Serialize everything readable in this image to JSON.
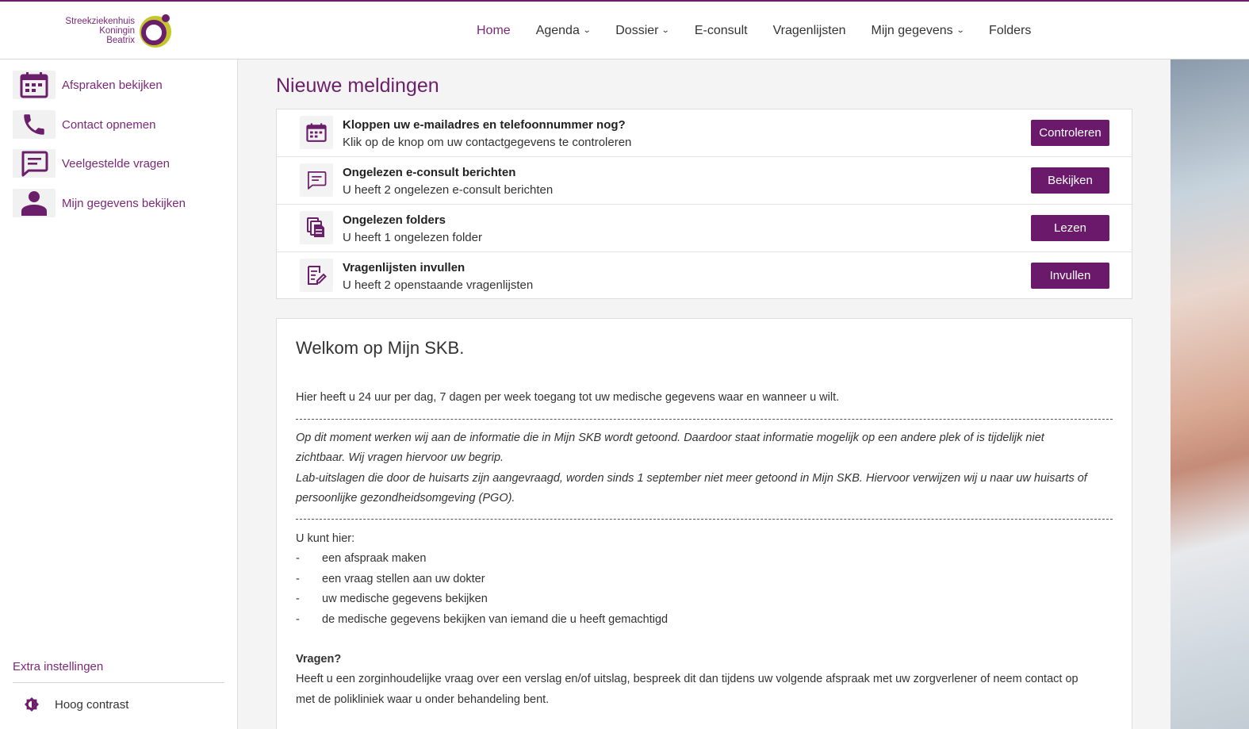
{
  "brand": {
    "logo_text": [
      "Streekziekenhuis",
      "Koningin",
      "Beatrix"
    ],
    "accent": "#7a2878",
    "button_color": "#6b1a6b"
  },
  "nav": [
    {
      "label": "Home",
      "active": true,
      "dropdown": false
    },
    {
      "label": "Agenda",
      "active": false,
      "dropdown": true
    },
    {
      "label": "Dossier",
      "active": false,
      "dropdown": true
    },
    {
      "label": "E-consult",
      "active": false,
      "dropdown": false
    },
    {
      "label": "Vragenlijsten",
      "active": false,
      "dropdown": false
    },
    {
      "label": "Mijn gegevens",
      "active": false,
      "dropdown": true
    },
    {
      "label": "Folders",
      "active": false,
      "dropdown": false
    }
  ],
  "sidebar": {
    "items": [
      {
        "label": "Afspraken bekijken",
        "icon": "calendar-icon"
      },
      {
        "label": "Contact opnemen",
        "icon": "phone-icon"
      },
      {
        "label": "Veelgestelde vragen",
        "icon": "chat-icon"
      },
      {
        "label": "Mijn gegevens bekijken",
        "icon": "person-icon"
      }
    ],
    "extra_title": "Extra instellingen",
    "contrast_label": "Hoog contrast"
  },
  "main": {
    "title": "Nieuwe meldingen",
    "notifications": [
      {
        "title": "Kloppen uw e-mailadres en telefoonnummer nog?",
        "subtitle": "Klik op de knop om uw contactgegevens te controleren",
        "button": "Controleren",
        "icon": "calendar-icon"
      },
      {
        "title": "Ongelezen e-consult berichten",
        "subtitle": "U heeft 2 ongelezen e-consult berichten",
        "button": "Bekijken",
        "icon": "chat-icon"
      },
      {
        "title": "Ongelezen folders",
        "subtitle": "U heeft 1 ongelezen folder",
        "button": "Lezen",
        "icon": "folders-icon"
      },
      {
        "title": "Vragenlijsten invullen",
        "subtitle": "U heeft 2 openstaande vragenlijsten",
        "button": "Invullen",
        "icon": "edit-list-icon"
      }
    ]
  },
  "welcome": {
    "title": "Welkom op Mijn SKB.",
    "intro": "Hier heeft u 24 uur per dag, 7 dagen per week toegang tot uw medische gegevens waar en wanneer u wilt.",
    "notice_lines": [
      "Op dit moment werken wij aan de informatie die in Mijn SKB wordt getoond. Daardoor staat informatie mogelijk op een andere plek of is tijdelijk niet",
      "zichtbaar. Wij vragen hiervoor uw begrip.",
      "Lab-uitslagen die door de huisarts zijn aangevraagd, worden sinds 1 september niet meer getoond in Mijn SKB. Hiervoor verwijzen wij u naar uw huisarts of",
      "persoonlijke gezondheidsomgeving (PGO)."
    ],
    "can_title": "U kunt hier:",
    "can_items": [
      "een afspraak maken",
      "een vraag stellen aan uw dokter",
      "uw medische gegevens bekijken",
      "de medische gegevens bekijken van iemand die u heeft gemachtigd"
    ],
    "list_marker": "-",
    "questions_title": "Vragen?",
    "questions_lines": [
      "Heeft u een zorginhoudelijke vraag over een verslag en/of uitslag, bespreek dit dan tijdens uw volgende afspraak met uw zorgverlener of neem contact op",
      "met de polikliniek waar u onder behandeling bent."
    ]
  }
}
